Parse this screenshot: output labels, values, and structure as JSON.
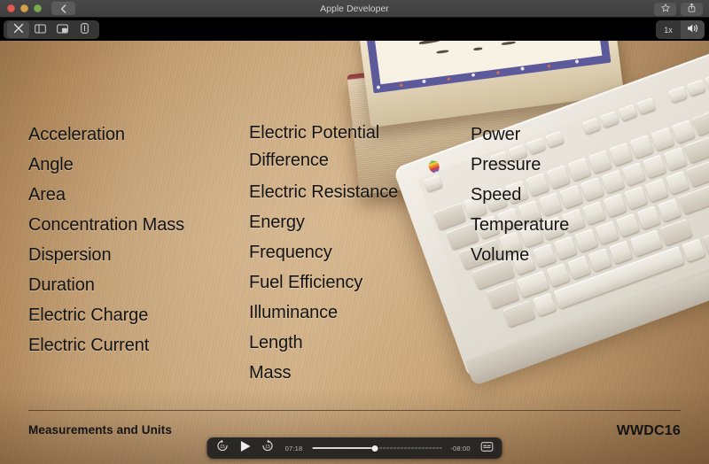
{
  "window": {
    "title": "Apple Developer",
    "traffic_lights": [
      "close",
      "minimize",
      "zoom"
    ],
    "back_label": "Back",
    "bookmark_label": "Bookmark",
    "share_label": "Share"
  },
  "player_toolbar": {
    "close_label": "Close",
    "sidebar_label": "Sidebar",
    "pip_label": "Picture in Picture",
    "airplay_label": "AirPlay",
    "speed_label": "1x",
    "volume_label": "Volume"
  },
  "slide": {
    "columns": [
      {
        "items": [
          "Acceleration",
          "Angle",
          "Area",
          "Concentration Mass",
          "Dispersion",
          "Duration",
          "Electric Charge",
          "Electric Current"
        ]
      },
      {
        "items": [
          "Electric Potential\nDifference",
          "Electric Resistance",
          "Energy",
          "Frequency",
          "Fuel Efficiency",
          "Illuminance",
          "Length",
          "Mass"
        ]
      },
      {
        "items": [
          "Power",
          "Pressure",
          "Speed",
          "Temperature",
          "Volume"
        ]
      }
    ],
    "footer_left": "Measurements and Units",
    "footer_right": "WWDC16"
  },
  "controls": {
    "skip_back_label": "15",
    "play_label": "Play",
    "skip_forward_label": "15",
    "current_time": "07:18",
    "remaining_time": "-08:00",
    "progress_percent": 48,
    "captions_label": "Subtitles and Captions"
  },
  "colors": {
    "titlebar": "#3e3e3e",
    "player_chrome": "#000000",
    "slide_text": "#141414",
    "desk_wood": "#cdac82",
    "accent_scrubber": "#d8d8d8"
  }
}
